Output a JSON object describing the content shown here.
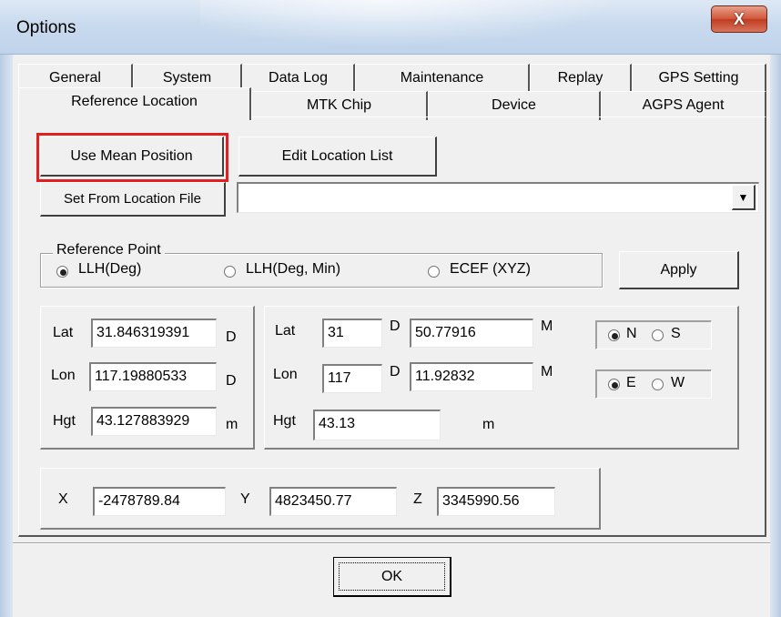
{
  "window": {
    "title": "Options",
    "close_glyph": "X"
  },
  "tabs_row1": [
    "General",
    "System",
    "Data Log",
    "Maintenance",
    "Replay",
    "GPS Setting"
  ],
  "tabs_row2": [
    "Reference Location",
    "MTK Chip",
    "Device",
    "AGPS Agent"
  ],
  "active_tab": "Reference Location",
  "buttons": {
    "use_mean": "Use Mean Position",
    "edit_list": "Edit Location List",
    "set_from_file": "Set From Location File",
    "apply": "Apply",
    "ok": "OK"
  },
  "location_file": {
    "value": "",
    "arrow": "▼"
  },
  "reference_point": {
    "legend": "Reference Point",
    "options": [
      "LLH(Deg)",
      "LLH(Deg, Min)",
      "ECEF (XYZ)"
    ],
    "selected": "LLH(Deg)"
  },
  "llh_deg": {
    "lat_label": "Lat",
    "lat": "31.846319391",
    "lat_unit": "D",
    "lon_label": "Lon",
    "lon": "117.19880533",
    "lon_unit": "D",
    "hgt_label": "Hgt",
    "hgt": "43.127883929",
    "hgt_unit": "m"
  },
  "llh_degmin": {
    "lat_label": "Lat",
    "lat_deg": "31",
    "lat_deg_unit": "D",
    "lat_min": "50.77916",
    "lat_min_unit": "M",
    "lon_label": "Lon",
    "lon_deg": "117",
    "lon_deg_unit": "D",
    "lon_min": "11.92832",
    "lon_min_unit": "M",
    "hgt_label": "Hgt",
    "hgt": "43.13",
    "hgt_unit": "m"
  },
  "hemisphere_ns": {
    "options": [
      "N",
      "S"
    ],
    "selected": "N"
  },
  "hemisphere_ew": {
    "options": [
      "E",
      "W"
    ],
    "selected": "E"
  },
  "ecef": {
    "x_label": "X",
    "x": "-2478789.84",
    "y_label": "Y",
    "y": "4823450.77",
    "z_label": "Z",
    "z": "3345990.56"
  }
}
